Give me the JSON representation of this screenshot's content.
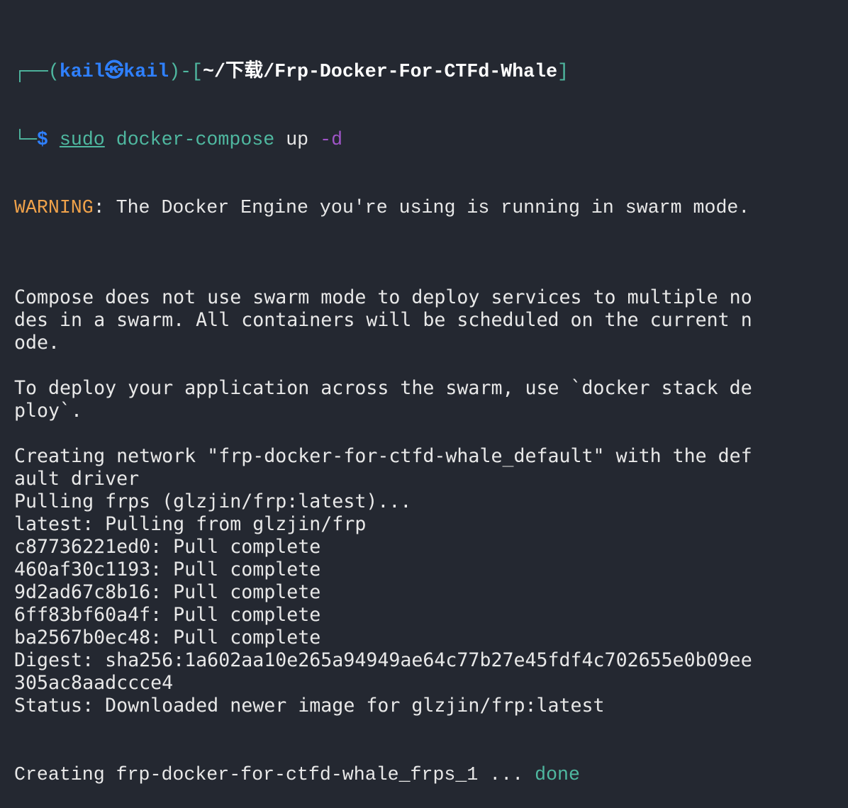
{
  "colors": {
    "background": "#242831",
    "text": "#e8e8e8",
    "prompt_frame": "#4fb8a0",
    "user": "#2f80ff",
    "warning": "#f0a24a",
    "flag": "#a055c8",
    "done": "#4fb8a0"
  },
  "prompt": {
    "frame_top": "┌──(",
    "user": "kail",
    "symbol": "㉿",
    "host": "kail",
    "mid": ")-[",
    "path": "~/下载/Frp-Docker-For-CTFd-Whale",
    "close": "]",
    "frame_bottom": "└─",
    "dollar": "$",
    "cmd_sudo": "sudo",
    "cmd_main": "docker-compose",
    "cmd_arg": "up",
    "cmd_flag": "-d"
  },
  "output": {
    "warning_label": "WARNING",
    "warning_text": ": The Docker Engine you're using is running in swarm mode.",
    "lines": [
      "",
      "Compose does not use swarm mode to deploy services to multiple no",
      "des in a swarm. All containers will be scheduled on the current n",
      "ode.",
      "",
      "To deploy your application across the swarm, use `docker stack de",
      "ploy`.",
      "",
      "Creating network \"frp-docker-for-ctfd-whale_default\" with the def",
      "ault driver",
      "Pulling frps (glzjin/frp:latest)...",
      "latest: Pulling from glzjin/frp",
      "c87736221ed0: Pull complete",
      "460af30c1193: Pull complete",
      "9d2ad67c8b16: Pull complete",
      "6ff83bf60a4f: Pull complete",
      "ba2567b0ec48: Pull complete",
      "Digest: sha256:1a602aa10e265a94949ae64c77b27e45fdf4c702655e0b09ee",
      "305ac8aadccce4",
      "Status: Downloaded newer image for glzjin/frp:latest"
    ],
    "final_line": "Creating frp-docker-for-ctfd-whale_frps_1 ... ",
    "final_status": "done"
  }
}
